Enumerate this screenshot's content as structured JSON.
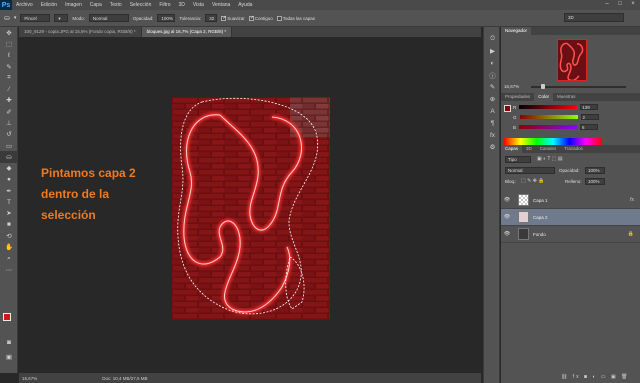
{
  "app": {
    "logo": "Ps"
  },
  "menu": [
    "Archivo",
    "Edición",
    "Imagen",
    "Capa",
    "Texto",
    "Selección",
    "Filtro",
    "3D",
    "Vista",
    "Ventana",
    "Ayuda"
  ],
  "window_controls": [
    "–",
    "□",
    "×"
  ],
  "options": {
    "preset": "Pincel",
    "mode_label": "Modo:",
    "mode_value": "Normal",
    "opacity_label": "Opacidad:",
    "opacity_value": "100%",
    "tolerance_label": "Tolerancia:",
    "tolerance_value": "32",
    "smooth_label": "Suavizar",
    "contiguous_label": "Contiguo",
    "all_layers_label": "Todas las capas",
    "workspace": "3D"
  },
  "tabs": [
    {
      "label": "100_9129 - copia.JPG al 15,6% (Fondo copia, RGB/8) *",
      "active": false
    },
    {
      "label": "bloques.jpg al 16,7% (Capa 2, RGB/8) *",
      "active": true
    }
  ],
  "annotation": {
    "line1": "Pintamos capa 2",
    "line2": "dentro de la",
    "line3": "selección"
  },
  "status": {
    "zoom": "16,67%",
    "doc": "Doc: 10,4 MB/27,5 MB"
  },
  "navigator": {
    "tab": "Navegador",
    "zoom": "16,67%"
  },
  "color_panel": {
    "tabs": [
      "Propiedades",
      "Color",
      "Muestras"
    ],
    "active_tab": "Color",
    "r_label": "R",
    "r_value": "139",
    "g_label": "G",
    "g_value": "2",
    "b_label": "B",
    "b_value": "6",
    "fg_color": "#8b0206"
  },
  "layers_panel": {
    "tabs": [
      "Capas",
      "3D",
      "Canales",
      "Trazados"
    ],
    "active_tab": "Capas",
    "filter": "Tipo",
    "blend_mode": "Normal",
    "opacity_label": "Opacidad:",
    "opacity_value": "100%",
    "lock_label": "Bloq.:",
    "fill_label": "Relleno:",
    "fill_value": "100%",
    "layers": [
      {
        "name": "Capa 1",
        "selected": false,
        "thumb": "transparent"
      },
      {
        "name": "Capa 2",
        "selected": true,
        "thumb": "figure"
      },
      {
        "name": "Fondo",
        "selected": false,
        "thumb": "bricks"
      }
    ]
  },
  "colors": {
    "foreground": "#d01818",
    "background": "#1c1c1c",
    "accent": "#f07a20"
  }
}
